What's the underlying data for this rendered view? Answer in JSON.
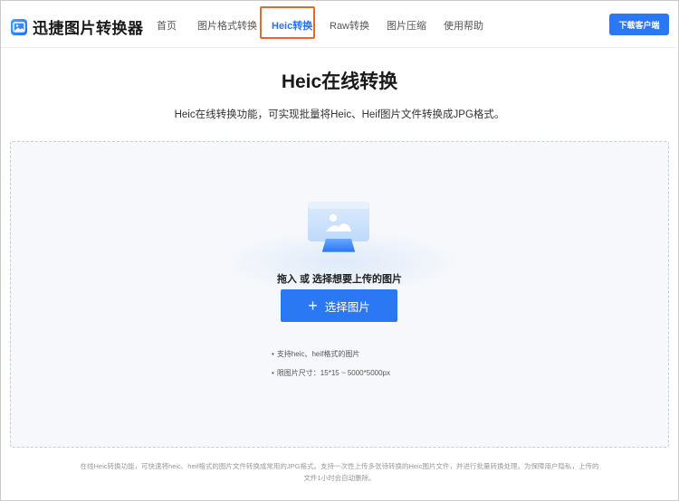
{
  "header": {
    "logo_text": "迅捷图片转换器",
    "nav": [
      {
        "label": "首页"
      },
      {
        "label": "图片格式转换"
      },
      {
        "label": "Heic转换"
      },
      {
        "label": "Raw转换"
      },
      {
        "label": "图片压缩"
      },
      {
        "label": "使用帮助"
      }
    ],
    "active_nav": "Heic转换",
    "download_label": "下载客户端"
  },
  "main": {
    "title": "Heic在线转换",
    "subtitle": "Heic在线转换功能，可实现批量将Heic、Heif图片文件转换成JPG格式。",
    "drop_text": "拖入 或 选择想要上传的图片",
    "select_button_label": "选择图片",
    "notes": [
      "支持heic、heif格式的图片",
      "限图片尺寸：15*15 ~ 5000*5000px"
    ],
    "footer_line1": "在线Heic转换功能，可快速将heic、heif格式的图片文件转换成常用的JPG格式。支持一次性上传多张待转换的Heic图片文件，并进行批量转换处理。为保障用户隐私，上传的",
    "footer_line2": "文件1小时会自动删除。"
  },
  "colors": {
    "accent": "#2b78f5",
    "active_highlight": "#e8672f",
    "upload_bg": "#f6f8fb"
  },
  "icons": {
    "logo": "image-icon",
    "upload_illustration": "image-upload-icon",
    "plus": "plus-icon"
  }
}
